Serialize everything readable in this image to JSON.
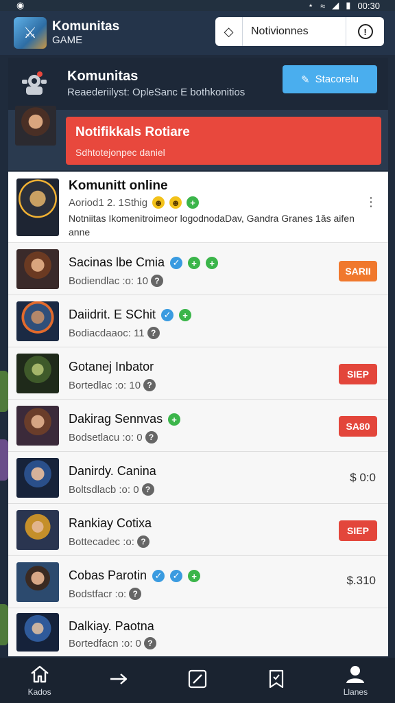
{
  "status_bar": {
    "time": "00:30"
  },
  "app": {
    "title": "Komunitas",
    "subtitle": "GAME"
  },
  "notifications_box": {
    "label": "Notivionnes"
  },
  "community": {
    "title": "Komunitas",
    "description": "Reaederiilyst: OpleSanc E bothkonitios",
    "button_label": "Stacorelu"
  },
  "alert": {
    "title": "Notifikkals Rotiare",
    "subtitle": "Sdhtotejonpec daniel"
  },
  "online_post": {
    "name": "Komunitt online",
    "meta": "Aoriod1 2. 1Sthig",
    "text": "Notniitas Ikomenitroimeor logodnodaDav, Gandra Granes 1ăs aifen anne"
  },
  "rows": [
    {
      "name": "Sacinas lbe Cmia",
      "meta": "Bodiendlac :o: 10",
      "tag": "SARII",
      "tag_color": "orange",
      "badges": [
        "blue",
        "green",
        "green"
      ]
    },
    {
      "name": "Daiidrit. E SChit",
      "meta": "Bodiacdaaoc: 11",
      "tag": "",
      "badges": [
        "blue",
        "green"
      ]
    },
    {
      "name": "Gotanej Inbator",
      "meta": "Bortedlac :o: 10",
      "tag": "SIEP",
      "tag_color": "red",
      "badges": []
    },
    {
      "name": "Dakirag Sennvas",
      "meta": "Bodsetlacu :o: 0",
      "tag": "SA80",
      "tag_color": "red",
      "badges": [
        "green"
      ]
    },
    {
      "name": "Danirdy. Canina",
      "meta": "Boltsdlacb :o: 0",
      "price": "$ 0:0",
      "badges": []
    },
    {
      "name": "Rankiay Cotixa",
      "meta": "Bottecadec :o:",
      "tag": "SIEP",
      "tag_color": "red",
      "badges": []
    },
    {
      "name": "Cobas Parotin",
      "meta": "Bodstfacr :o:",
      "price": "$.310",
      "badges": [
        "blue",
        "blue",
        "green"
      ]
    },
    {
      "name": "Dalkiay. Paotna",
      "meta": "Bortedfacn :o: 0",
      "badges": []
    }
  ],
  "nav": [
    {
      "label": "Kados",
      "icon": "home-icon"
    },
    {
      "label": "",
      "icon": "arrow-icon"
    },
    {
      "label": "",
      "icon": "edit-icon"
    },
    {
      "label": "",
      "icon": "bookmark-icon"
    },
    {
      "label": "Llanes",
      "icon": "profile-icon"
    }
  ]
}
